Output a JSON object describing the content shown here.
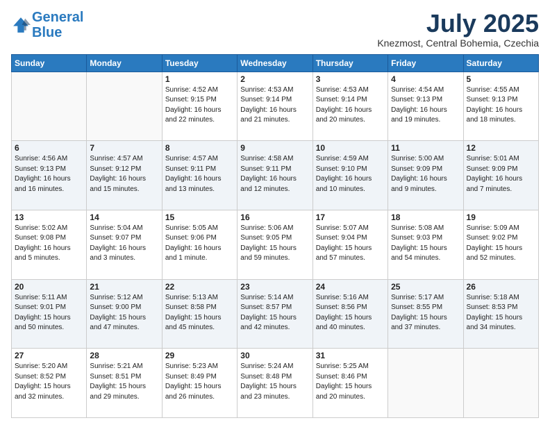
{
  "header": {
    "logo_line1": "General",
    "logo_line2": "Blue",
    "month_year": "July 2025",
    "location": "Knezmost, Central Bohemia, Czechia"
  },
  "weekdays": [
    "Sunday",
    "Monday",
    "Tuesday",
    "Wednesday",
    "Thursday",
    "Friday",
    "Saturday"
  ],
  "weeks": [
    [
      {
        "day": "",
        "info": ""
      },
      {
        "day": "",
        "info": ""
      },
      {
        "day": "1",
        "info": "Sunrise: 4:52 AM\nSunset: 9:15 PM\nDaylight: 16 hours\nand 22 minutes."
      },
      {
        "day": "2",
        "info": "Sunrise: 4:53 AM\nSunset: 9:14 PM\nDaylight: 16 hours\nand 21 minutes."
      },
      {
        "day": "3",
        "info": "Sunrise: 4:53 AM\nSunset: 9:14 PM\nDaylight: 16 hours\nand 20 minutes."
      },
      {
        "day": "4",
        "info": "Sunrise: 4:54 AM\nSunset: 9:13 PM\nDaylight: 16 hours\nand 19 minutes."
      },
      {
        "day": "5",
        "info": "Sunrise: 4:55 AM\nSunset: 9:13 PM\nDaylight: 16 hours\nand 18 minutes."
      }
    ],
    [
      {
        "day": "6",
        "info": "Sunrise: 4:56 AM\nSunset: 9:13 PM\nDaylight: 16 hours\nand 16 minutes."
      },
      {
        "day": "7",
        "info": "Sunrise: 4:57 AM\nSunset: 9:12 PM\nDaylight: 16 hours\nand 15 minutes."
      },
      {
        "day": "8",
        "info": "Sunrise: 4:57 AM\nSunset: 9:11 PM\nDaylight: 16 hours\nand 13 minutes."
      },
      {
        "day": "9",
        "info": "Sunrise: 4:58 AM\nSunset: 9:11 PM\nDaylight: 16 hours\nand 12 minutes."
      },
      {
        "day": "10",
        "info": "Sunrise: 4:59 AM\nSunset: 9:10 PM\nDaylight: 16 hours\nand 10 minutes."
      },
      {
        "day": "11",
        "info": "Sunrise: 5:00 AM\nSunset: 9:09 PM\nDaylight: 16 hours\nand 9 minutes."
      },
      {
        "day": "12",
        "info": "Sunrise: 5:01 AM\nSunset: 9:09 PM\nDaylight: 16 hours\nand 7 minutes."
      }
    ],
    [
      {
        "day": "13",
        "info": "Sunrise: 5:02 AM\nSunset: 9:08 PM\nDaylight: 16 hours\nand 5 minutes."
      },
      {
        "day": "14",
        "info": "Sunrise: 5:04 AM\nSunset: 9:07 PM\nDaylight: 16 hours\nand 3 minutes."
      },
      {
        "day": "15",
        "info": "Sunrise: 5:05 AM\nSunset: 9:06 PM\nDaylight: 16 hours\nand 1 minute."
      },
      {
        "day": "16",
        "info": "Sunrise: 5:06 AM\nSunset: 9:05 PM\nDaylight: 15 hours\nand 59 minutes."
      },
      {
        "day": "17",
        "info": "Sunrise: 5:07 AM\nSunset: 9:04 PM\nDaylight: 15 hours\nand 57 minutes."
      },
      {
        "day": "18",
        "info": "Sunrise: 5:08 AM\nSunset: 9:03 PM\nDaylight: 15 hours\nand 54 minutes."
      },
      {
        "day": "19",
        "info": "Sunrise: 5:09 AM\nSunset: 9:02 PM\nDaylight: 15 hours\nand 52 minutes."
      }
    ],
    [
      {
        "day": "20",
        "info": "Sunrise: 5:11 AM\nSunset: 9:01 PM\nDaylight: 15 hours\nand 50 minutes."
      },
      {
        "day": "21",
        "info": "Sunrise: 5:12 AM\nSunset: 9:00 PM\nDaylight: 15 hours\nand 47 minutes."
      },
      {
        "day": "22",
        "info": "Sunrise: 5:13 AM\nSunset: 8:58 PM\nDaylight: 15 hours\nand 45 minutes."
      },
      {
        "day": "23",
        "info": "Sunrise: 5:14 AM\nSunset: 8:57 PM\nDaylight: 15 hours\nand 42 minutes."
      },
      {
        "day": "24",
        "info": "Sunrise: 5:16 AM\nSunset: 8:56 PM\nDaylight: 15 hours\nand 40 minutes."
      },
      {
        "day": "25",
        "info": "Sunrise: 5:17 AM\nSunset: 8:55 PM\nDaylight: 15 hours\nand 37 minutes."
      },
      {
        "day": "26",
        "info": "Sunrise: 5:18 AM\nSunset: 8:53 PM\nDaylight: 15 hours\nand 34 minutes."
      }
    ],
    [
      {
        "day": "27",
        "info": "Sunrise: 5:20 AM\nSunset: 8:52 PM\nDaylight: 15 hours\nand 32 minutes."
      },
      {
        "day": "28",
        "info": "Sunrise: 5:21 AM\nSunset: 8:51 PM\nDaylight: 15 hours\nand 29 minutes."
      },
      {
        "day": "29",
        "info": "Sunrise: 5:23 AM\nSunset: 8:49 PM\nDaylight: 15 hours\nand 26 minutes."
      },
      {
        "day": "30",
        "info": "Sunrise: 5:24 AM\nSunset: 8:48 PM\nDaylight: 15 hours\nand 23 minutes."
      },
      {
        "day": "31",
        "info": "Sunrise: 5:25 AM\nSunset: 8:46 PM\nDaylight: 15 hours\nand 20 minutes."
      },
      {
        "day": "",
        "info": ""
      },
      {
        "day": "",
        "info": ""
      }
    ]
  ]
}
